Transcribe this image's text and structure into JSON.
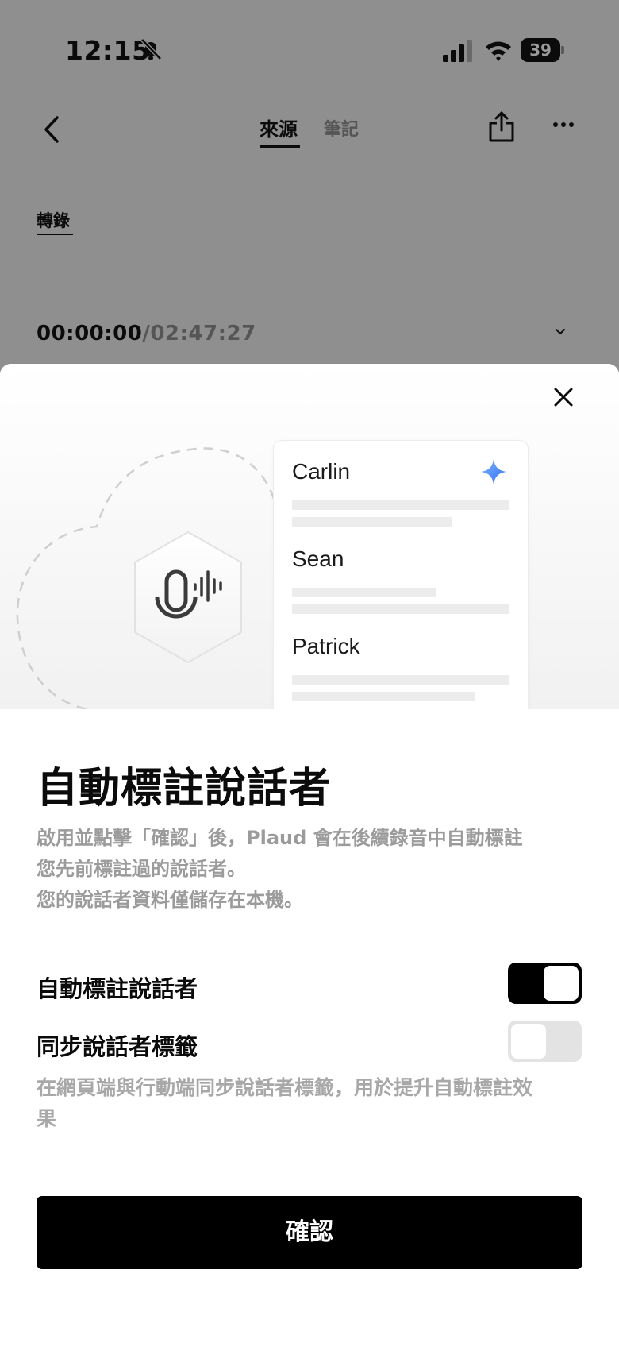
{
  "status": {
    "time": "12:15",
    "battery": "39"
  },
  "nav": {
    "tabs": [
      "來源",
      "筆記"
    ],
    "active_tab": "來源"
  },
  "subtab": "轉錄",
  "player": {
    "current": "00:00:00",
    "separator": "/",
    "total": "02:47:27"
  },
  "illustration": {
    "speakers": [
      "Carlin",
      "Sean",
      "Patrick"
    ]
  },
  "sheet": {
    "title": "自動標註說話者",
    "description": [
      "啟用並點擊「確認」後，Plaud 會在後續錄音中自動標註",
      "您先前標註過的說話者。",
      "您的說話者資料僅儲存在本機。"
    ],
    "settings": [
      {
        "label": "自動標註說話者",
        "enabled": true
      },
      {
        "label": "同步說話者標籤",
        "enabled": false
      }
    ],
    "sync_hint": [
      "在網頁端與行動端同步說話者標籤，用於提升自動標註效",
      "果"
    ],
    "confirm_label": "確認"
  }
}
